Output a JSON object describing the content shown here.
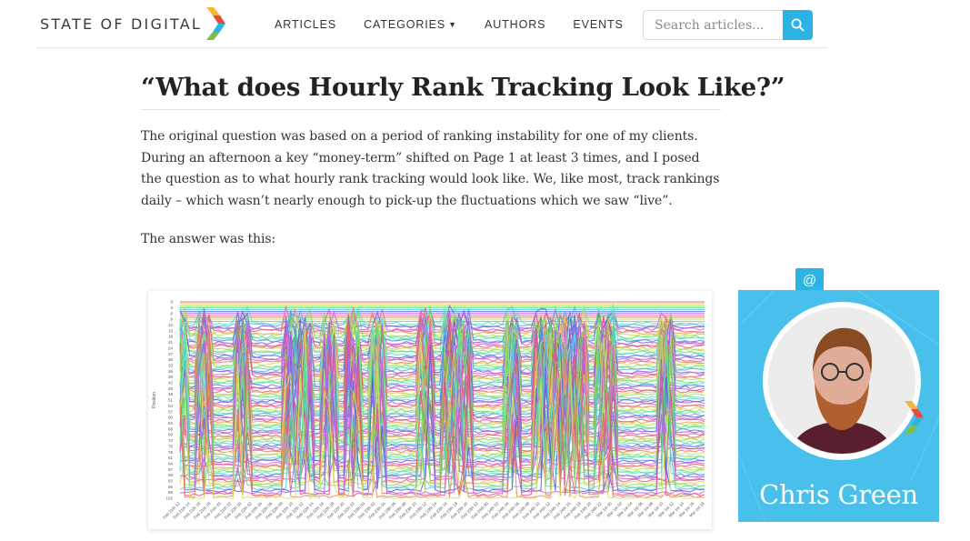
{
  "brand": {
    "name": "STATE OF DIGITAL",
    "colors": {
      "accent": "#2bb4e3",
      "author_bg": "#49c0ec",
      "chevron": [
        "#f4b63f",
        "#e94a3f",
        "#2bb4e3",
        "#7cbf4a"
      ]
    }
  },
  "nav": {
    "items": [
      {
        "label": "ARTICLES"
      },
      {
        "label": "CATEGORIES",
        "has_dropdown": true
      },
      {
        "label": "AUTHORS"
      },
      {
        "label": "EVENTS"
      }
    ]
  },
  "search": {
    "placeholder": "Search articles...",
    "icon": "search-icon"
  },
  "article": {
    "title": "“What does Hourly Rank Tracking Look Like?”",
    "paragraphs": [
      "The original question was based on a period of ranking instability for one of my clients. During an afternoon a key “money-term” shifted on Page 1 at least 3 times, and I posed the question as to what hourly rank tracking would look like. We, like most, track rankings daily – which wasn’t nearly enough to pick-up the fluctuations which we saw “live”.",
      "The answer was this:"
    ]
  },
  "chart_data": {
    "type": "line",
    "title": "",
    "xlabel": "",
    "ylabel": "Position",
    "y_ticks": [
      "0",
      "3",
      "6",
      "9",
      "12",
      "15",
      "18",
      "21",
      "24",
      "27",
      "30",
      "33",
      "36",
      "39",
      "42",
      "45",
      "48",
      "51",
      "54",
      "57",
      "60",
      "63",
      "66",
      "69",
      "72",
      "75",
      "78",
      "81",
      "84",
      "87",
      "90",
      "93",
      "96",
      "99",
      "102"
    ],
    "y_inverted": true,
    "ylim": [
      0,
      102
    ],
    "series_count": 102,
    "x_ticks": [
      "Feb 21th 12",
      "Feb 21th 14",
      "Feb 21th 16",
      "Feb 21th 18",
      "Feb 21th 20",
      "Feb 21th 22",
      "Feb 22th 00",
      "Feb 22th 02",
      "Feb 22th 04",
      "Feb 22th 06",
      "Feb 22th 08",
      "Feb 22th 10",
      "Feb 22th 12",
      "Feb 22th 14",
      "Feb 22th 16",
      "Feb 22th 18",
      "Feb 22th 20",
      "Feb 22th 22",
      "Feb 23th 00",
      "Feb 23th 02",
      "Feb 23th 04",
      "Feb 23th 06",
      "Feb 23th 08",
      "Feb 23th 10",
      "Feb 23th 12",
      "Feb 23th 14",
      "Feb 23th 16",
      "Feb 23th 18",
      "Feb 23th 20",
      "Feb 23th 22",
      "Feb 24th 00",
      "Feb 24th 02",
      "Feb 24th 04",
      "Feb 24th 06",
      "Feb 24th 08",
      "Feb 24th 10",
      "Feb 24th 12",
      "Feb 24th 14",
      "Feb 24th 16",
      "Feb 24th 18",
      "Feb 24th 20",
      "Feb 24th 22",
      "Mar 1st 00",
      "Mar 1st 02",
      "Mar 1st 04",
      "Mar 1st 06",
      "Mar 1st 08",
      "Mar 1st 10",
      "Mar 1st 12",
      "Mar 1st 14",
      "Mar 1st 16",
      "Mar 1st 18"
    ],
    "grid": false
  },
  "author": {
    "name": "Chris Green",
    "badge": "@",
    "badge_icon": "at-icon"
  }
}
